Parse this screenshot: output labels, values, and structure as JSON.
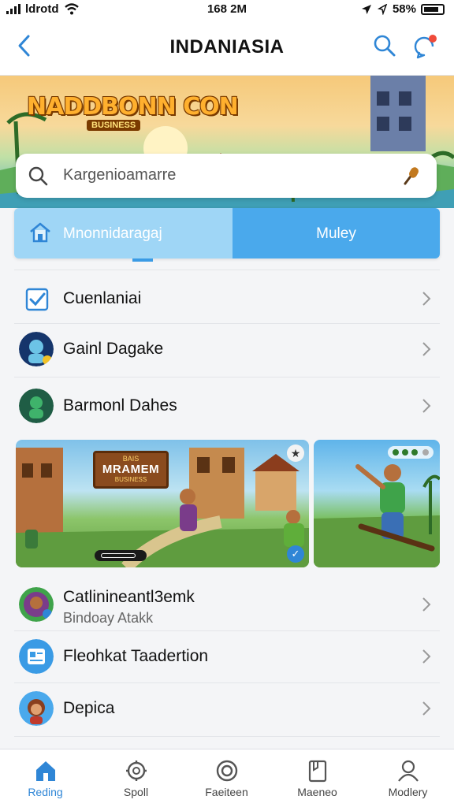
{
  "status_bar": {
    "carrier": "ldrotd",
    "time": "168 2M",
    "battery": "58%"
  },
  "nav": {
    "title": "INDANIASIA"
  },
  "hero": {
    "logo_text": "NADDBONN CON",
    "logo_sub": "BUSINESS"
  },
  "search": {
    "placeholder": "Kargenioamarre"
  },
  "segments": {
    "left_label": "Mnonnidaragaj",
    "right_label": "Muley"
  },
  "list_top": [
    {
      "title": "Cuenlaniai",
      "icon": "checkbox-icon"
    },
    {
      "title": "Gainl Dagake",
      "icon": "avatar-blue"
    },
    {
      "title": "Barmonl Dahes",
      "icon": "avatar-green"
    }
  ],
  "banner": {
    "sign_top": "BAIS",
    "sign_title": "MRAMEM",
    "sign_sub": "BUSINESS"
  },
  "list_bottom": [
    {
      "title": "Catlinineantl3emk",
      "subtitle": "Bindoay Atakk",
      "icon": "avatar-green"
    },
    {
      "title": "Fleohkat Taadertion",
      "icon": "id-card-icon"
    },
    {
      "title": "Depica",
      "icon": "avatar-girl"
    }
  ],
  "tab_bar": {
    "items": [
      {
        "label": "Reding",
        "icon": "home-icon",
        "active": true
      },
      {
        "label": "Spoll",
        "icon": "gear-icon",
        "active": false
      },
      {
        "label": "Faeiteen",
        "icon": "compass-icon",
        "active": false
      },
      {
        "label": "Maeneo",
        "icon": "document-icon",
        "active": false
      },
      {
        "label": "Modlery",
        "icon": "person-icon",
        "active": false
      }
    ]
  },
  "colors": {
    "accent": "#2f86d6",
    "segment_left": "#9fd6f6",
    "segment_right": "#4aa9ec"
  }
}
